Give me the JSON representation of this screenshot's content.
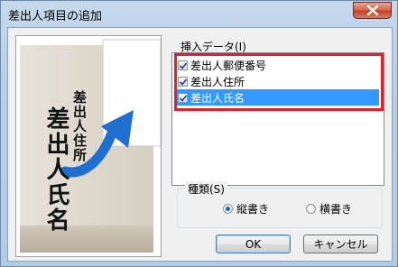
{
  "window": {
    "title": "差出人項目の追加"
  },
  "preview": {
    "sender_address": "差出人住所",
    "sender_name": "差出人氏名"
  },
  "insert_data": {
    "label": "挿入データ(I)",
    "items": [
      {
        "label": "差出人郵便番号",
        "checked": true,
        "selected": false
      },
      {
        "label": "差出人住所",
        "checked": true,
        "selected": false
      },
      {
        "label": "差出人氏名",
        "checked": true,
        "selected": true
      }
    ]
  },
  "kind": {
    "label": "種類(S)",
    "options": [
      {
        "label": "縦書き",
        "selected": true
      },
      {
        "label": "横書き",
        "selected": false
      }
    ]
  },
  "buttons": {
    "ok": "OK",
    "cancel": "キャンセル"
  },
  "colors": {
    "highlight": "#e0202a",
    "selection": "#3399ff",
    "arrow": "#1e6fd0"
  }
}
